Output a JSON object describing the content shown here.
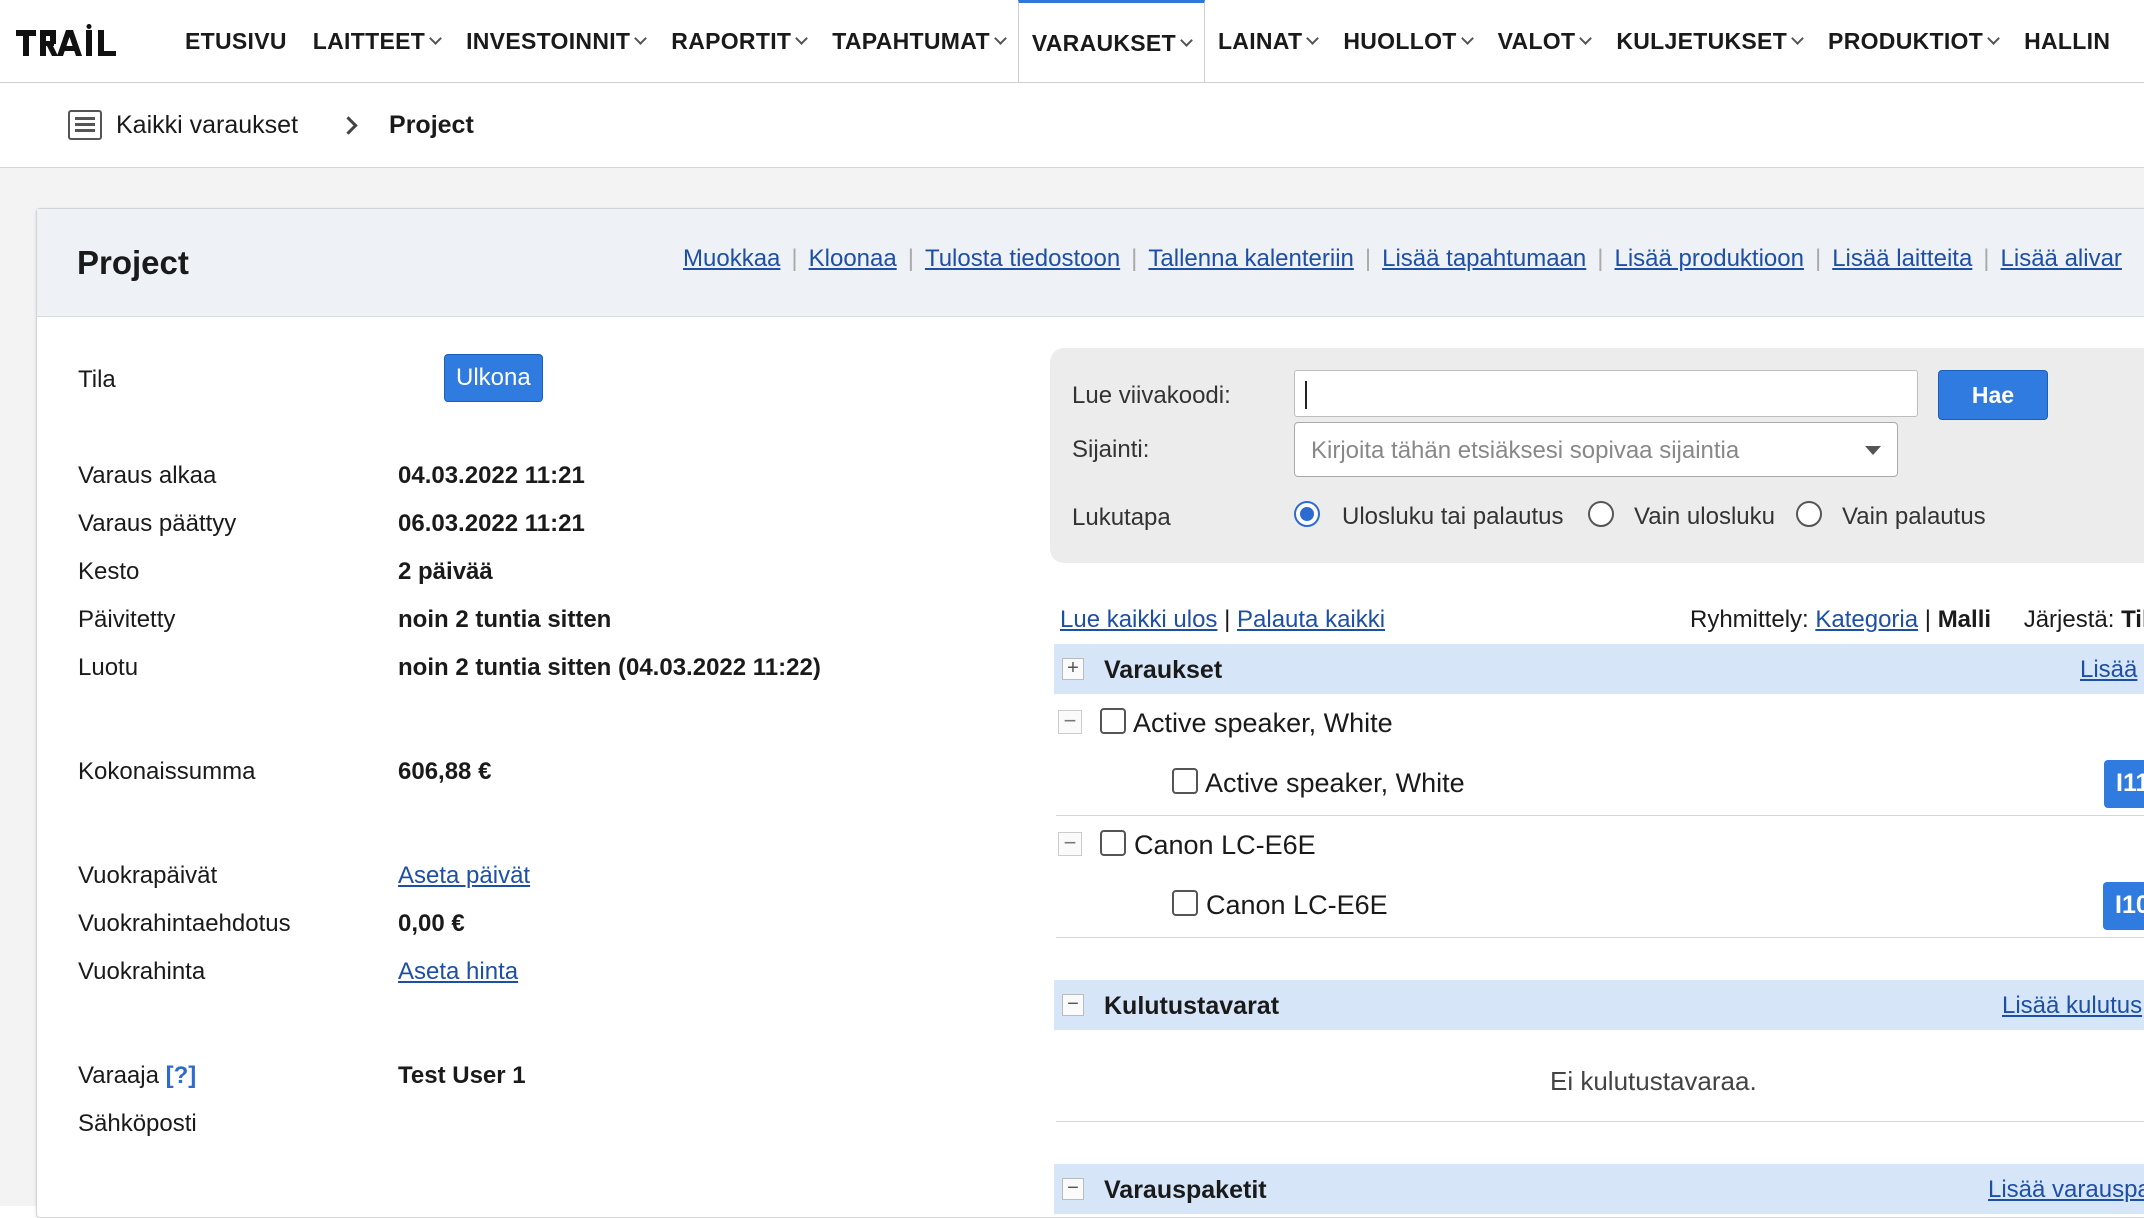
{
  "app": {
    "logo_text": "TRAIL"
  },
  "nav": {
    "items": [
      {
        "label": "ETUSIVU",
        "dropdown": false
      },
      {
        "label": "LAITTEET",
        "dropdown": true
      },
      {
        "label": "INVESTOINNIT",
        "dropdown": true
      },
      {
        "label": "RAPORTIT",
        "dropdown": true
      },
      {
        "label": "TAPAHTUMAT",
        "dropdown": true
      },
      {
        "label": "VARAUKSET",
        "dropdown": true,
        "active": true
      },
      {
        "label": "LAINAT",
        "dropdown": true
      },
      {
        "label": "HUOLLOT",
        "dropdown": true
      },
      {
        "label": "VALOT",
        "dropdown": true
      },
      {
        "label": "KULJETUKSET",
        "dropdown": true
      },
      {
        "label": "PRODUKTIOT",
        "dropdown": true
      },
      {
        "label": "HALLIN",
        "dropdown": false
      }
    ]
  },
  "breadcrumb": {
    "parent": "Kaikki varaukset",
    "current": "Project"
  },
  "card": {
    "title": "Project",
    "actions": [
      "Muokkaa",
      "Kloonaa",
      "Tulosta tiedostoon",
      "Tallenna kalenteriin",
      "Lisää tapahtumaan",
      "Lisää produktioon",
      "Lisää laitteita",
      "Lisää alivar"
    ]
  },
  "details": {
    "status_label": "Tila",
    "status_value": "Ulkona",
    "start_label": "Varaus alkaa",
    "start_value": "04.03.2022 11:21",
    "end_label": "Varaus päättyy",
    "end_value": "06.03.2022 11:21",
    "duration_label": "Kesto",
    "duration_value": "2 päivää",
    "updated_label": "Päivitetty",
    "updated_value": "noin 2 tuntia sitten",
    "created_label": "Luotu",
    "created_value": "noin 2 tuntia sitten (04.03.2022 11:22)",
    "total_label": "Kokonaissumma",
    "total_value": "606,88 €",
    "rental_days_label": "Vuokrapäivät",
    "rental_days_value": "Aseta päivät",
    "rental_suggestion_label": "Vuokrahintaehdotus",
    "rental_suggestion_value": "0,00 €",
    "rental_price_label": "Vuokrahinta",
    "rental_price_value": "Aseta hinta",
    "booker_label": "Varaaja",
    "booker_help": "[?]",
    "booker_value": "Test User 1",
    "email_label": "Sähköposti"
  },
  "scan": {
    "barcode_label": "Lue viivakoodi:",
    "barcode_value": "",
    "search_button": "Hae",
    "location_label": "Sijainti:",
    "location_placeholder": "Kirjoita tähän etsiäksesi sopivaa sijaintia",
    "mode_label": "Lukutapa",
    "modes": [
      {
        "label": "Ulosluku tai palautus",
        "selected": true
      },
      {
        "label": "Vain ulosluku",
        "selected": false
      },
      {
        "label": "Vain palautus",
        "selected": false
      }
    ]
  },
  "list_toolbar": {
    "checkout_all": "Lue kaikki ulos",
    "sep": "|",
    "return_all": "Palauta kaikki",
    "group_label": "Ryhmittely:",
    "group_category": "Kategoria",
    "group_model": "Malli",
    "sort_label": "Järjestä:",
    "sort_value": "Til"
  },
  "sections": {
    "bookings": {
      "title": "Varaukset",
      "toggle": "+",
      "action": "Lisää"
    },
    "consumables": {
      "title": "Kulutustavarat",
      "toggle": "−",
      "action": "Lisää kulutus",
      "empty": "Ei kulutustavaraa."
    },
    "packages": {
      "title": "Varauspaketit",
      "toggle": "−",
      "action": "Lisää varauspa"
    }
  },
  "booking_items": [
    {
      "group": "Active speaker, White",
      "item": "Active speaker, White",
      "tag": "I11"
    },
    {
      "group": "Canon LC-E6E",
      "item": "Canon LC-E6E",
      "tag": "I10"
    }
  ],
  "colors": {
    "accent": "#2f7be0",
    "link": "#1d4fa6",
    "section_bg": "#d6e6f8"
  }
}
